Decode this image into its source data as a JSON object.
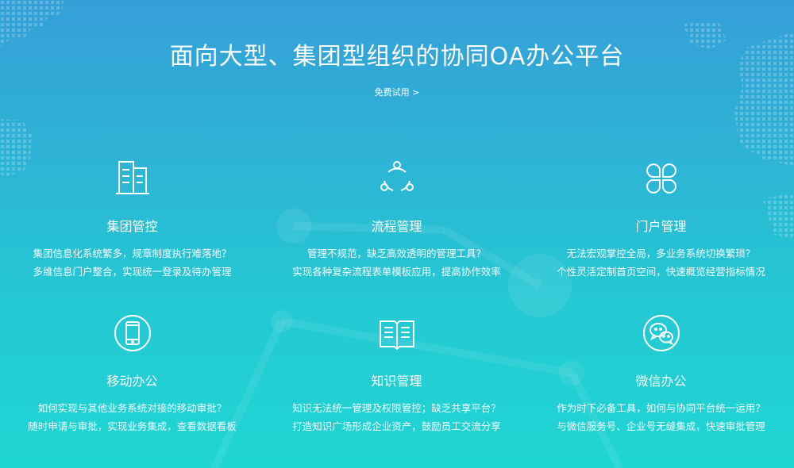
{
  "hero": {
    "title": "面向大型、集团型组织的协同OA办公平台",
    "cta": "免费试用 >"
  },
  "features": [
    {
      "title": "集团管控",
      "icon": "buildings-icon",
      "desc": [
        "集团信息化系统繁多，规章制度执行难落地？",
        "多维信息门户整合，实现统一登录及待办管理"
      ]
    },
    {
      "title": "流程管理",
      "icon": "cycle-nodes-icon",
      "desc": [
        "管理不规范，缺乏高效透明的管理工具？",
        "实现各种复杂流程表单模板应用，提高协作效率"
      ]
    },
    {
      "title": "门户管理",
      "icon": "clover-icon",
      "desc": [
        "无法宏观掌控全局，多业务系统切换繁琐？",
        "个性灵活定制首页空间，快速概览经营指标情况"
      ]
    },
    {
      "title": "移动办公",
      "icon": "mobile-phone-icon",
      "desc": [
        "如何实现与其他业务系统对接的移动审批？",
        "随时申请与审批，实现业务集成，查看数据看板"
      ]
    },
    {
      "title": "知识管理",
      "icon": "open-book-icon",
      "desc": [
        "知识无法统一管理及权限管控；缺乏共享平台？",
        "打造知识广场形成企业资产，鼓励员工交流分享"
      ]
    },
    {
      "title": "微信办公",
      "icon": "wechat-icon",
      "desc": [
        "作为时下必备工具，如何与协同平台统一运用？",
        "与微信服务号、企业号无缝集成，快速审批管理"
      ]
    }
  ],
  "colors": {
    "gradient_top": "#35a0d8",
    "gradient_bottom": "#1fd6d3",
    "text": "#ffffff"
  }
}
